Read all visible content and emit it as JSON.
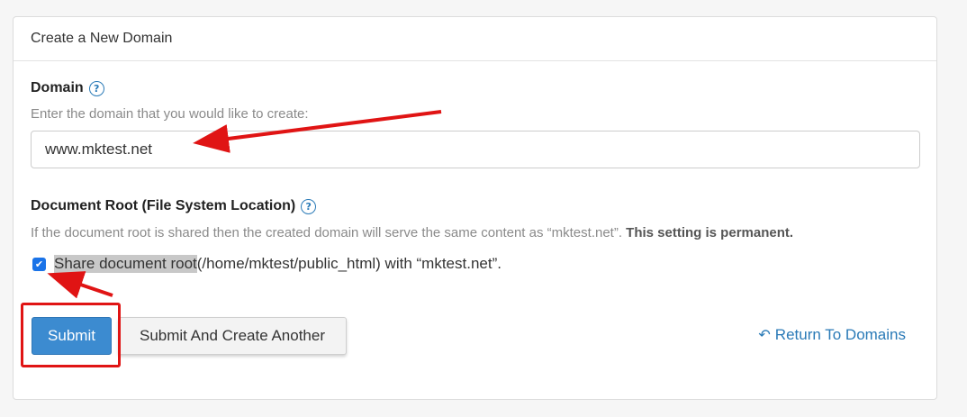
{
  "panel": {
    "title": "Create a New Domain"
  },
  "domain": {
    "label": "Domain",
    "help_icon": "?",
    "hint": "Enter the domain that you would like to create:",
    "value": "www.mktest.net"
  },
  "docroot": {
    "label": "Document Root (File System Location)",
    "help_icon": "?",
    "hint": "If the document root is shared then the created domain will serve the same content as “mktest.net”.",
    "hint_bold": "This setting is permanent.",
    "checkbox_checked": true,
    "checkbox_mark": "✔",
    "share_highlight": "Share document root",
    "share_rest": " (/home/mktest/public_html) with “mktest.net”."
  },
  "actions": {
    "submit_label": "Submit",
    "submit_another_label": "Submit And Create Another",
    "return_icon": "↶",
    "return_label": "Return To Domains"
  },
  "colors": {
    "primary": "#3c8bd0",
    "link": "#2a7ab7",
    "annotation_red": "#e01414"
  }
}
